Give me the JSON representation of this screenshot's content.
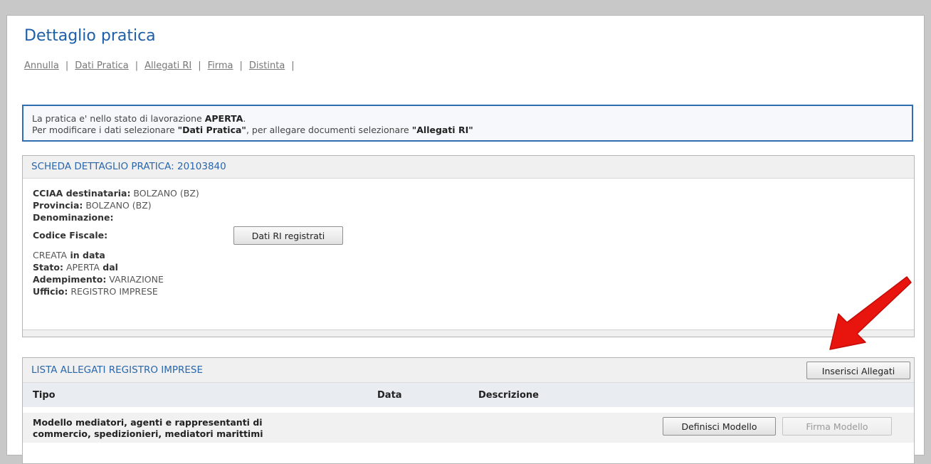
{
  "header": {
    "title": "Dettaglio pratica"
  },
  "nav": [
    "Annulla",
    "Dati Pratica",
    "Allegati RI",
    "Firma",
    "Distinta"
  ],
  "nav_separator": "|",
  "notice": {
    "line1_prefix": "La pratica e' nello stato di lavorazione ",
    "line1_state": "APERTA",
    "line1_suffix": ".",
    "line2_a": "Per modificare i dati selezionare ",
    "line2_b": "\"Dati Pratica\"",
    "line2_c": ", per allegare documenti selezionare ",
    "line2_d": "\"Allegati RI\""
  },
  "detail": {
    "heading": "SCHEDA DETTAGLIO PRATICA: 20103840",
    "cciaa_label": "CCIAA destinataria:",
    "cciaa_value": " BOLZANO (BZ)",
    "provincia_label": "Provincia:",
    "provincia_value": " BOLZANO (BZ)",
    "denominazione_label": "Denominazione:",
    "codice_fiscale_label": "Codice Fiscale:",
    "dati_ri_button": "Dati RI registrati",
    "creata_value": "CREATA",
    "creata_label": " in data",
    "stato_label": "Stato:",
    "stato_value": " APERTA",
    "stato_dal": " dal",
    "adempimento_label": "Adempimento:",
    "adempimento_value": " VARIAZIONE",
    "ufficio_label": "Ufficio:",
    "ufficio_value": " REGISTRO IMPRESE"
  },
  "attachments": {
    "heading": "LISTA ALLEGATI REGISTRO IMPRESE",
    "insert_button": "Inserisci Allegati",
    "columns": {
      "tipo": "Tipo",
      "data": "Data",
      "descrizione": "Descrizione"
    },
    "rows": [
      {
        "tipo_line1": "Modello mediatori, agenti e rappresentanti di",
        "tipo_line2": "commercio, spedizionieri, mediatori marittimi",
        "define_button": "Definisci Modello",
        "sign_button": "Firma Modello"
      }
    ]
  },
  "colors": {
    "accent": "#1d5ea8",
    "notice_border": "#2f6eb5",
    "arrow": "#e8140e"
  }
}
